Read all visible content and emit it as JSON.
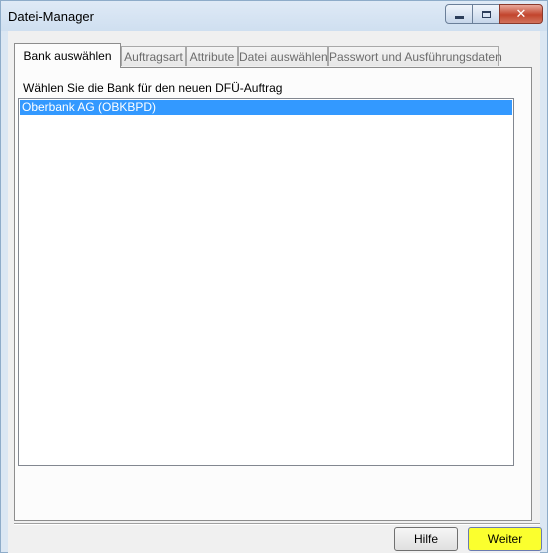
{
  "window": {
    "title": "Datei-Manager",
    "close_glyph": "✕"
  },
  "tabs": [
    {
      "label": "Bank auswählen",
      "active": true
    },
    {
      "label": "Auftragsart",
      "active": false
    },
    {
      "label": "Attribute",
      "active": false
    },
    {
      "label": "Datei auswählen",
      "active": false
    },
    {
      "label": "Passwort und Ausführungsdaten",
      "active": false
    }
  ],
  "panel": {
    "prompt": "Wählen Sie die Bank für den neuen DFÜ-Auftrag",
    "banks": [
      {
        "label": "Oberbank AG (OBKBPD)",
        "selected": true
      }
    ]
  },
  "buttons": {
    "help_label": "Hilfe",
    "next_label": "Weiter"
  },
  "colors": {
    "selection": "#3399ff",
    "highlight": "#fbff2e"
  }
}
